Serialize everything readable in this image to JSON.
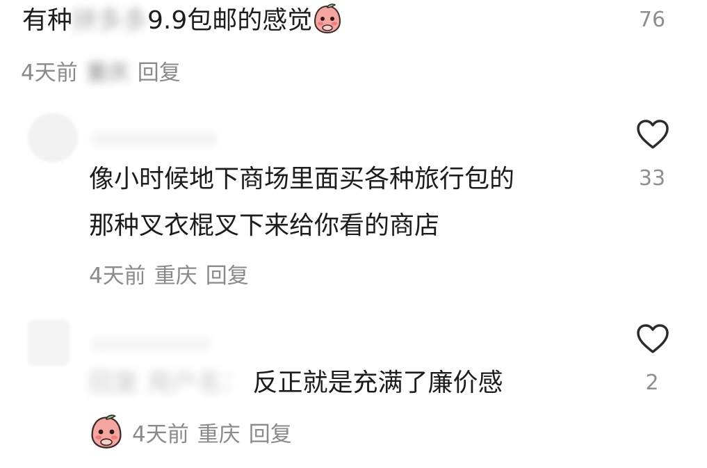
{
  "comments": [
    {
      "text_pre": "有种",
      "text_hidden": "拼多多",
      "text_post": "9.9包邮的感觉",
      "emoji": "blushing-peach-emoji",
      "likes": "76",
      "time": "4天前",
      "location": "重庆",
      "reply": "回复"
    },
    {
      "line1": "像小时候地下商场里面买各种旅行包的",
      "line2": "那种叉衣棍叉下来给你看的商店",
      "likes": "33",
      "time": "4天前",
      "location": "重庆",
      "reply": "回复",
      "heart_icon": "heart-outline-icon"
    },
    {
      "text_hidden": "回复 用户名：",
      "text": "反正就是充满了廉价感",
      "emoji": "blushing-peach-emoji",
      "likes": "2",
      "time": "4天前",
      "location": "重庆",
      "reply": "回复",
      "heart_icon": "heart-outline-icon"
    }
  ]
}
